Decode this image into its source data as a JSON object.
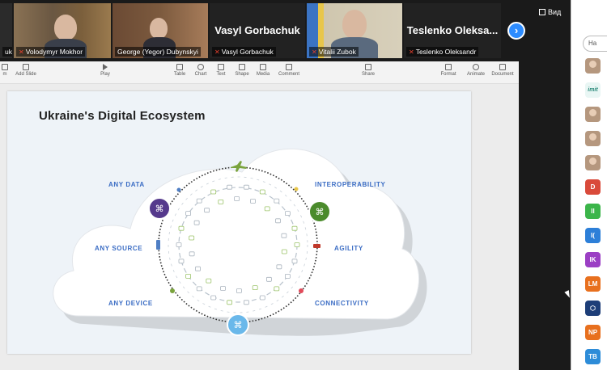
{
  "video_strip": {
    "participants": [
      {
        "name": "uk",
        "muted": false
      },
      {
        "name": "Volodymyr Mokhor",
        "muted": true
      },
      {
        "name": "George (Yegor) Dubynskyi",
        "muted": false
      },
      {
        "name": "Vasyl Gorbachuk",
        "muted": true,
        "camera_off_name": "Vasyl Gorbachuk"
      },
      {
        "name": "Vitalii Zubok",
        "muted": true
      },
      {
        "name": "Teslenko Oleksandr",
        "muted": true,
        "camera_off_name": "Teslenko  Oleksa..."
      }
    ],
    "next_icon": "chevron-right-icon",
    "view_label": "Вид"
  },
  "toolbar": {
    "left_items": [
      "m",
      "Add Slide"
    ],
    "items": [
      "Play",
      "Table",
      "Chart",
      "Text",
      "Shape",
      "Media",
      "Comment",
      "Share",
      "Format",
      "Animate",
      "Document"
    ]
  },
  "slide": {
    "title": "Ukraine's Digital Ecosystem",
    "labels": {
      "any_data": "ANY DATA",
      "any_source": "ANY SOURCE",
      "any_device": "ANY DEVICE",
      "interoperability": "INTEROPERABILITY",
      "agility": "AGILITY",
      "connectivity": "CONNECTIVITY"
    },
    "colors": {
      "purple": "#55398c",
      "green": "#4b8b2c",
      "blue": "#6ab8ea",
      "label": "#3a6cc4"
    }
  },
  "sidebar": {
    "search_placeholder": "На",
    "avatars": [
      {
        "kind": "photo",
        "text": ""
      },
      {
        "kind": "logo",
        "text": "imit"
      },
      {
        "kind": "photo",
        "text": ""
      },
      {
        "kind": "photo",
        "text": ""
      },
      {
        "kind": "photo",
        "text": ""
      },
      {
        "kind": "initials",
        "text": "D",
        "color": "#d94a3a"
      },
      {
        "kind": "initials",
        "text": "II",
        "color": "#3bb54a"
      },
      {
        "kind": "initials",
        "text": "I(",
        "color": "#2d7fd8"
      },
      {
        "kind": "initials",
        "text": "IK",
        "color": "#9b3fc4"
      },
      {
        "kind": "initials",
        "text": "LM",
        "color": "#e8701e"
      },
      {
        "kind": "initials",
        "text": "⬡",
        "color": "#1d3e78"
      },
      {
        "kind": "initials",
        "text": "NP",
        "color": "#e8701e"
      },
      {
        "kind": "initials",
        "text": "TB",
        "color": "#2d8cd8"
      }
    ]
  }
}
